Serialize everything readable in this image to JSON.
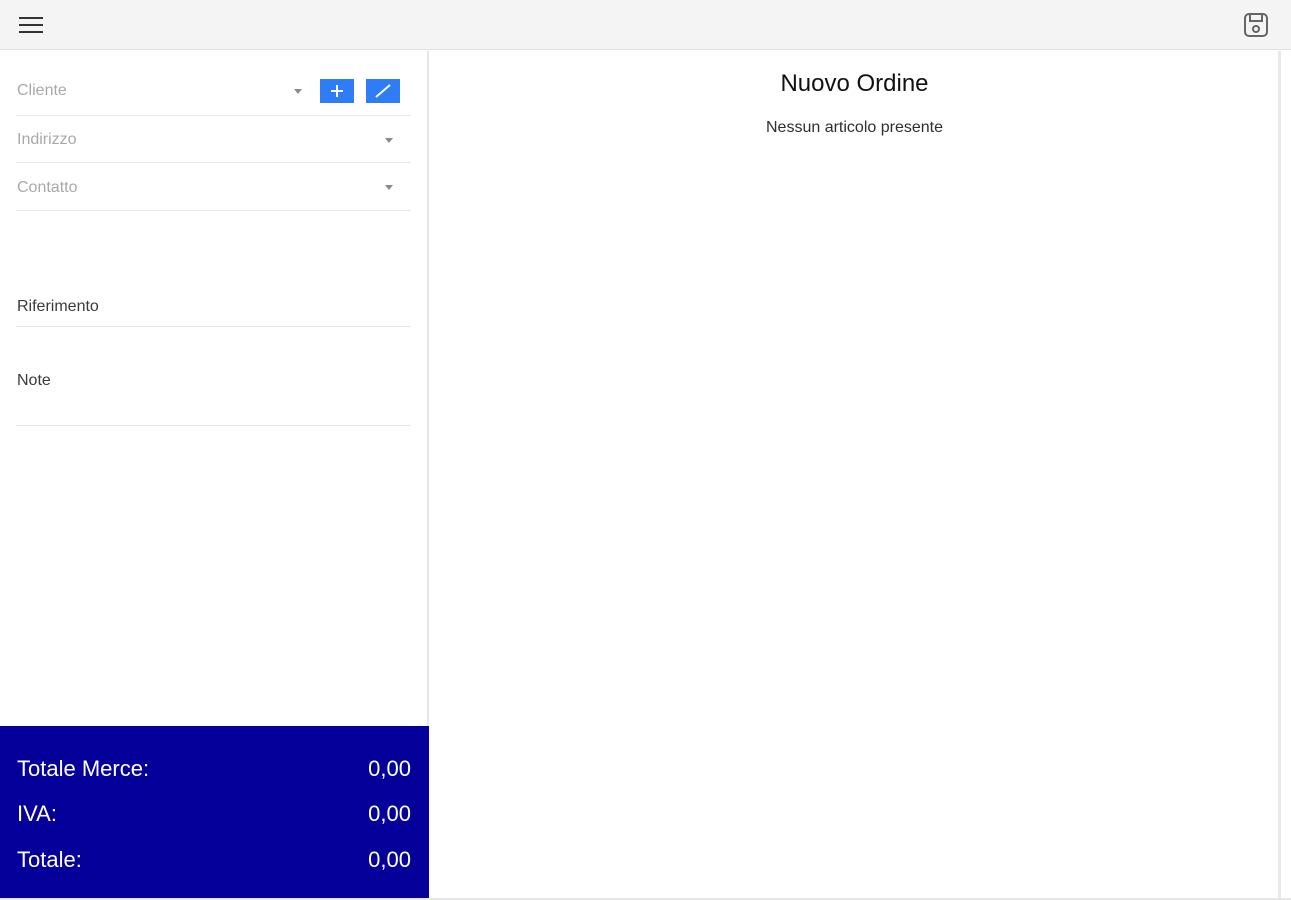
{
  "header": {
    "menu_icon": "hamburger-menu-icon",
    "save_icon": "save-disk-icon"
  },
  "form": {
    "cliente_placeholder": "Cliente",
    "indirizzo_placeholder": "Indirizzo",
    "contatto_placeholder": "Contatto",
    "riferimento_label": "Riferimento",
    "note_label": "Note"
  },
  "totals": {
    "merce_label": "Totale Merce:",
    "merce_value": "0,00",
    "iva_label": "IVA:",
    "iva_value": "0,00",
    "totale_label": "Totale:",
    "totale_value": "0,00"
  },
  "main": {
    "title": "Nuovo Ordine",
    "empty_message": "Nessun articolo presente"
  },
  "colors": {
    "accent": "#2f7df6",
    "totals_bg": "#06009b"
  }
}
